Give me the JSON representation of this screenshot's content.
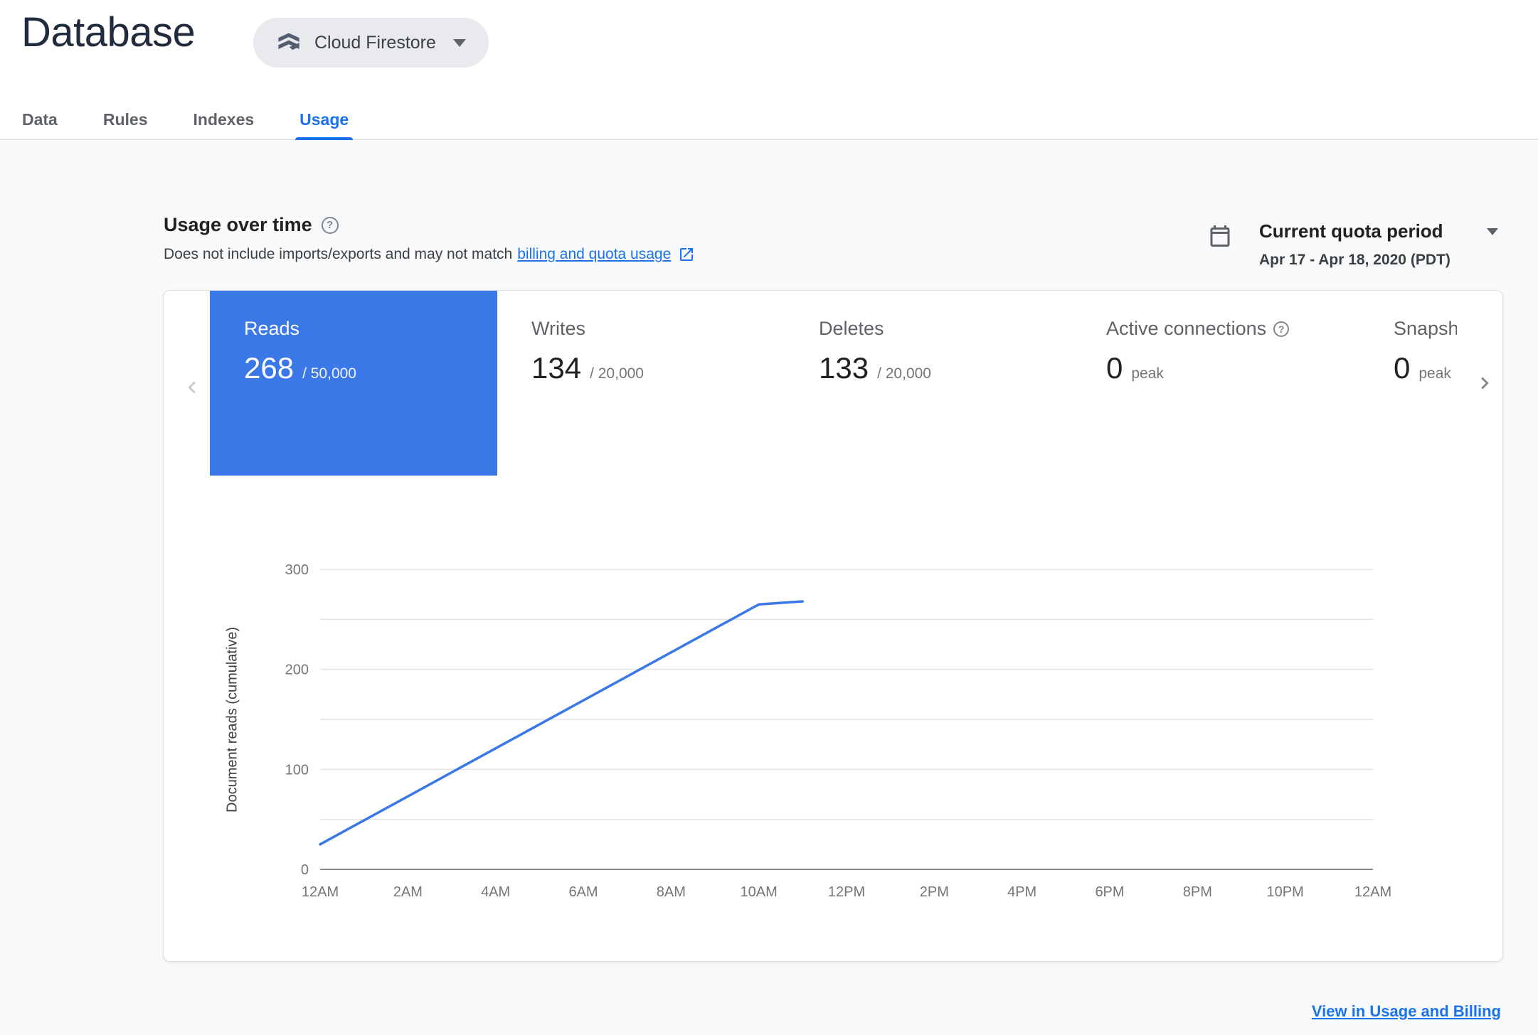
{
  "page": {
    "title": "Database",
    "product_selector_label": "Cloud Firestore"
  },
  "tabs": [
    {
      "label": "Data",
      "active": false
    },
    {
      "label": "Rules",
      "active": false
    },
    {
      "label": "Indexes",
      "active": false
    },
    {
      "label": "Usage",
      "active": true
    }
  ],
  "usage_header": {
    "title": "Usage over time",
    "subtitle_text": "Does not include imports/exports and may not match",
    "subtitle_link_label": "billing and quota usage",
    "period_label": "Current quota period",
    "period_value": "Apr 17 - Apr 18, 2020 (PDT)"
  },
  "metrics": [
    {
      "label": "Reads",
      "value": "268",
      "denominator": "/ 50,000",
      "selected": true
    },
    {
      "label": "Writes",
      "value": "134",
      "denominator": "/ 20,000",
      "selected": false
    },
    {
      "label": "Deletes",
      "value": "133",
      "denominator": "/ 20,000",
      "selected": false
    },
    {
      "label": "Active connections",
      "value": "0",
      "denominator": "peak",
      "selected": false,
      "has_help": true
    },
    {
      "label": "Snapshot listeners",
      "value": "0",
      "denominator": "peak",
      "selected": false
    }
  ],
  "icons": {
    "help_glyph": "?"
  },
  "colors": {
    "accent_blue": "#1a73e8",
    "selected_tile_blue": "#3b78e7",
    "chart_line_blue": "#3b78e7"
  },
  "chart_data": {
    "type": "line",
    "title": "Usage over time",
    "ylabel": "Document reads (cumulative)",
    "xlabel": "",
    "xlim_hours": [
      0,
      24
    ],
    "ylim": [
      0,
      300
    ],
    "x_ticks_hours": [
      0,
      2,
      4,
      6,
      8,
      10,
      12,
      14,
      16,
      18,
      20,
      22,
      24
    ],
    "x_tick_labels": [
      "12AM",
      "2AM",
      "4AM",
      "6AM",
      "8AM",
      "10AM",
      "12PM",
      "2PM",
      "4PM",
      "6PM",
      "8PM",
      "10PM",
      "12AM"
    ],
    "y_ticks": [
      0,
      50,
      100,
      150,
      200,
      250,
      300
    ],
    "y_label_ticks": [
      0,
      100,
      200,
      300
    ],
    "grid": "horizontal",
    "legend": "none",
    "series": [
      {
        "name": "Reads (cumulative)",
        "color": "#3b78e7",
        "points": [
          {
            "x": 0,
            "y": 25
          },
          {
            "x": 10,
            "y": 265
          },
          {
            "x": 11,
            "y": 268
          }
        ]
      }
    ]
  },
  "footer": {
    "link_label": "View in Usage and Billing"
  }
}
